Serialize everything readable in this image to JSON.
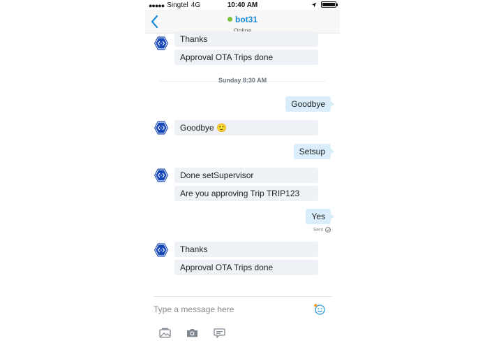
{
  "status_bar": {
    "carrier": "Singtel",
    "network": "4G",
    "time": "10:40 AM"
  },
  "header": {
    "contact_name": "bot31",
    "contact_status": "Online"
  },
  "messages": [
    {
      "sender": "bot",
      "text": "Thanks"
    },
    {
      "sender": "bot",
      "text": "Approval OTA Trips done"
    },
    {
      "sender": "user",
      "text": "Goodbye"
    },
    {
      "sender": "bot",
      "text": "Goodbye",
      "emoji": "🙂"
    },
    {
      "sender": "user",
      "text": "Setsup"
    },
    {
      "sender": "bot",
      "text": "Done setSupervisor"
    },
    {
      "sender": "bot",
      "text": "Are you approving Trip TRIP123"
    },
    {
      "sender": "user",
      "text": "Yes"
    },
    {
      "sender": "bot",
      "text": "Thanks"
    },
    {
      "sender": "bot",
      "text": "Approval OTA Trips done"
    }
  ],
  "date_separator": "Sunday 8:30 AM",
  "sent_label": "Sent",
  "composer": {
    "placeholder": "Type a message here"
  },
  "colors": {
    "accent": "#1a8ad6",
    "online": "#7cc142",
    "bot_avatar": "#1647b8",
    "bot_bubble": "#eef1f5",
    "user_bubble": "#d9eefa"
  },
  "icons": {
    "back": "chevron-left-icon",
    "bot": "hexagon-code-icon",
    "emoji": "smiley-icon",
    "gallery": "image-gallery-icon",
    "camera": "camera-icon",
    "chat": "chat-bubble-icon"
  }
}
